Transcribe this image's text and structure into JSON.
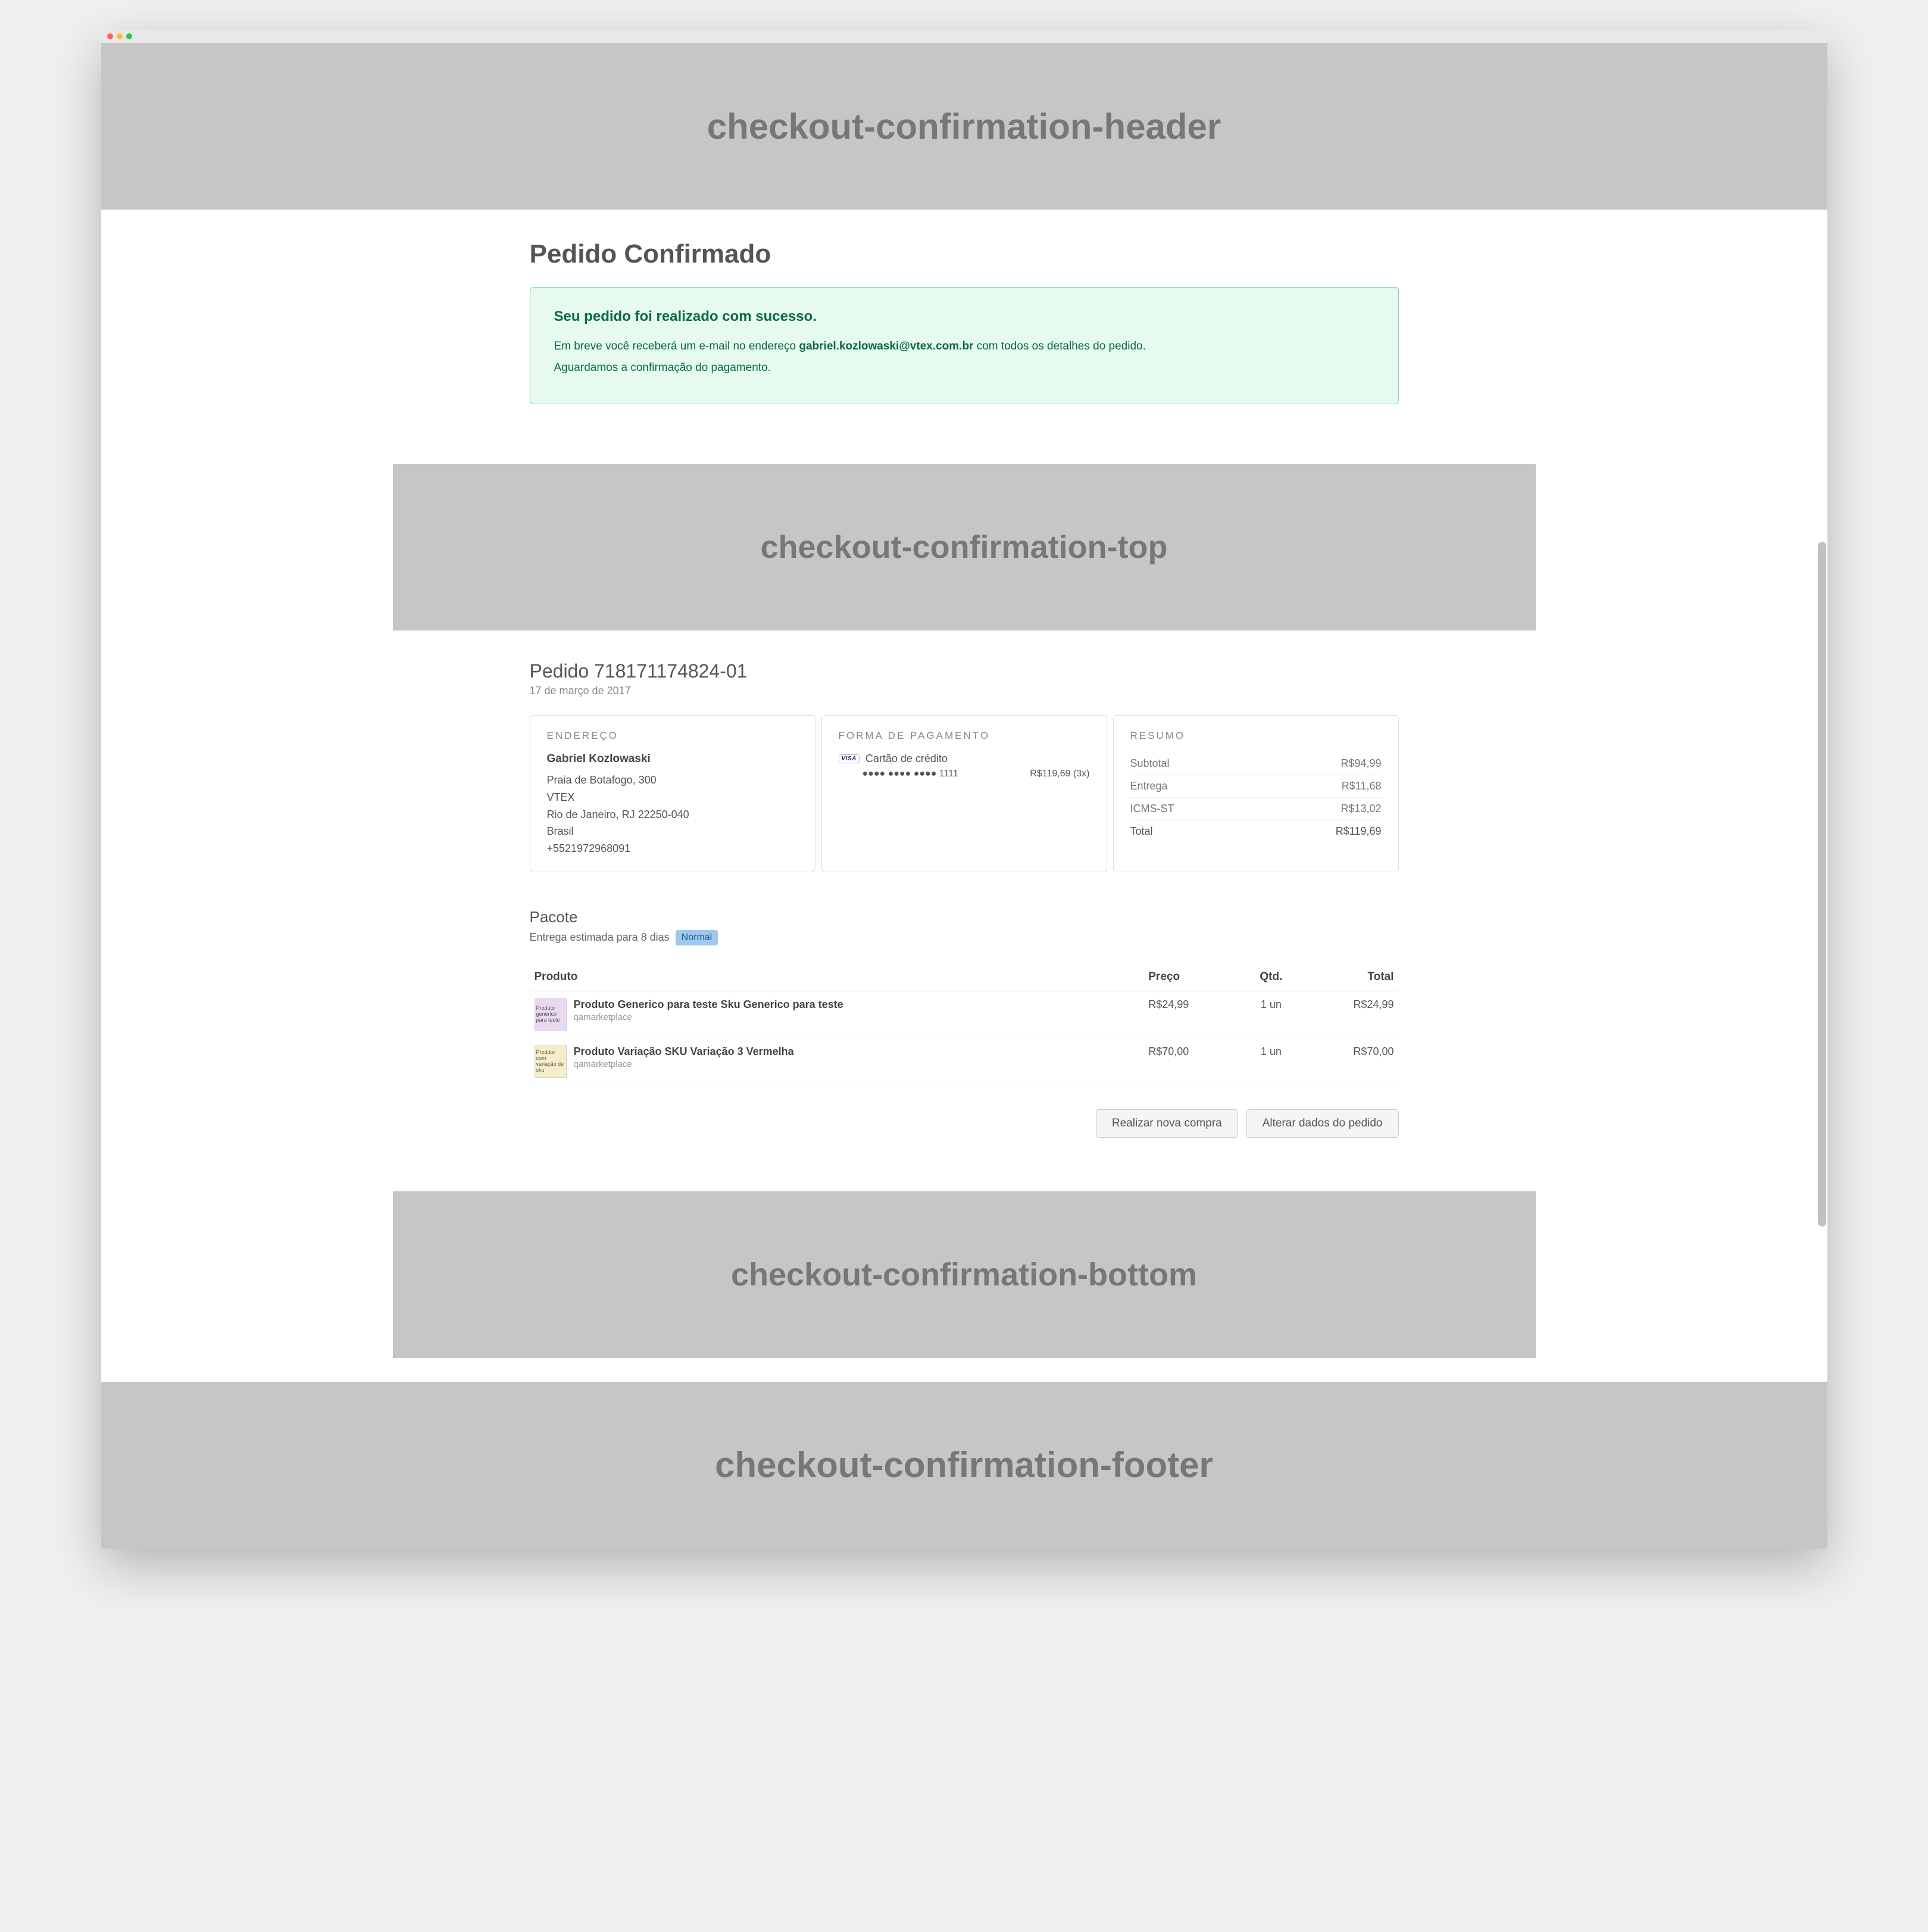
{
  "placeholders": {
    "header": "checkout-confirmation-header",
    "top": "checkout-confirmation-top",
    "bottom": "checkout-confirmation-bottom",
    "footer": "checkout-confirmation-footer"
  },
  "page_title": "Pedido Confirmado",
  "success": {
    "title": "Seu pedido foi realizado com sucesso.",
    "line1_pre": "Em breve você receberá um e-mail no endereço ",
    "email": "gabriel.kozlowaski@vtex.com.br",
    "line1_post": " com todos os detalhes do pedido.",
    "line2": "Aguardamos a confirmação do pagamento."
  },
  "order": {
    "heading": "Pedido 718171174824-01",
    "date": "17 de março de 2017"
  },
  "address": {
    "heading": "ENDEREÇO",
    "name": "Gabriel Kozlowaski",
    "street": "Praia de Botafogo, 300",
    "company": "VTEX",
    "city_state_zip": "Rio de Janeiro, RJ 22250-040",
    "country": "Brasil",
    "phone": "+5521972968091"
  },
  "payment": {
    "heading": "FORMA DE PAGAMENTO",
    "brand": "VISA",
    "method": "Cartão de crédito",
    "masked": "●●●● ●●●● ●●●● 1111",
    "amount": "R$119,69 (3x)"
  },
  "summary": {
    "heading": "RESUMO",
    "rows": [
      {
        "label": "Subtotal",
        "value": "R$94,99"
      },
      {
        "label": "Entrega",
        "value": "R$11,68"
      },
      {
        "label": "ICMS-ST",
        "value": "R$13,02"
      }
    ],
    "total_label": "Total",
    "total_value": "R$119,69"
  },
  "package": {
    "title": "Pacote",
    "estimate": "Entrega estimada para 8 dias",
    "badge": "Normal"
  },
  "table": {
    "headers": {
      "product": "Produto",
      "price": "Preço",
      "qty": "Qtd.",
      "total": "Total"
    },
    "rows": [
      {
        "thumb_text": "Produto generico para teste",
        "thumb_class": "purple",
        "name": "Produto Generico para teste Sku Generico para teste",
        "seller": "qamarketplace",
        "price": "R$24,99",
        "qty": "1 un",
        "total": "R$24,99"
      },
      {
        "thumb_text": "Produto com variação de sku",
        "thumb_class": "yellow",
        "name": "Produto Variação SKU Variação 3 Vermelha",
        "seller": "qamarketplace",
        "price": "R$70,00",
        "qty": "1 un",
        "total": "R$70,00"
      }
    ]
  },
  "actions": {
    "new_order": "Realizar nova compra",
    "edit_order": "Alterar dados do pedido"
  }
}
